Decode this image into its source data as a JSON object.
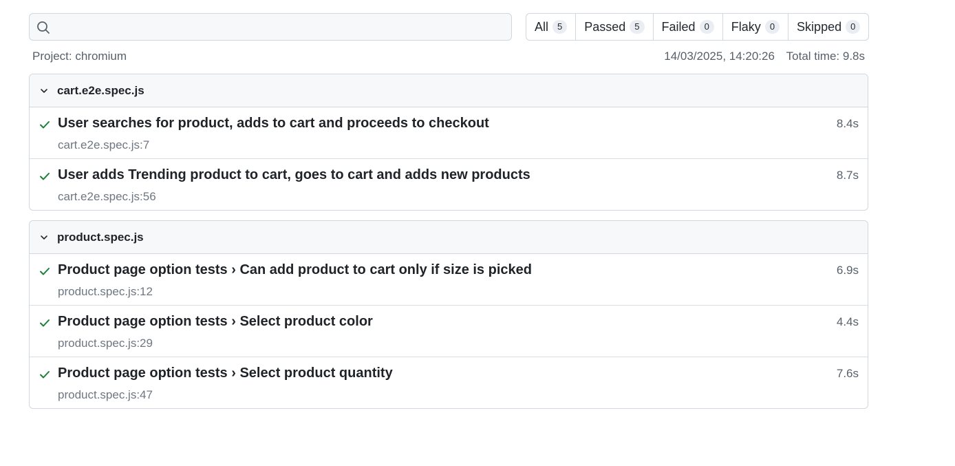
{
  "search": {
    "placeholder": "",
    "value": ""
  },
  "filters": [
    {
      "label": "All",
      "count": "5"
    },
    {
      "label": "Passed",
      "count": "5"
    },
    {
      "label": "Failed",
      "count": "0"
    },
    {
      "label": "Flaky",
      "count": "0"
    },
    {
      "label": "Skipped",
      "count": "0"
    }
  ],
  "project": "Project: chromium",
  "timestamp": "14/03/2025, 14:20:26",
  "total_time": "Total time: 9.8s",
  "colors": {
    "pass": "#1a7f37",
    "border": "#d0d7de",
    "header_bg": "#f6f8fa"
  },
  "files": [
    {
      "name": "cart.e2e.spec.js",
      "tests": [
        {
          "title": "User searches for product, adds to cart and proceeds to checkout",
          "location": "cart.e2e.spec.js:7",
          "duration": "8.4s",
          "status_icon": "check-icon"
        },
        {
          "title": "User adds Trending product to cart, goes to cart and adds new products",
          "location": "cart.e2e.spec.js:56",
          "duration": "8.7s",
          "status_icon": "check-icon"
        }
      ]
    },
    {
      "name": "product.spec.js",
      "tests": [
        {
          "title": "Product page option tests › Can add product to cart only if size is picked",
          "location": "product.spec.js:12",
          "duration": "6.9s",
          "status_icon": "check-icon"
        },
        {
          "title": "Product page option tests › Select product color",
          "location": "product.spec.js:29",
          "duration": "4.4s",
          "status_icon": "check-icon"
        },
        {
          "title": "Product page option tests › Select product quantity",
          "location": "product.spec.js:47",
          "duration": "7.6s",
          "status_icon": "check-icon"
        }
      ]
    }
  ]
}
